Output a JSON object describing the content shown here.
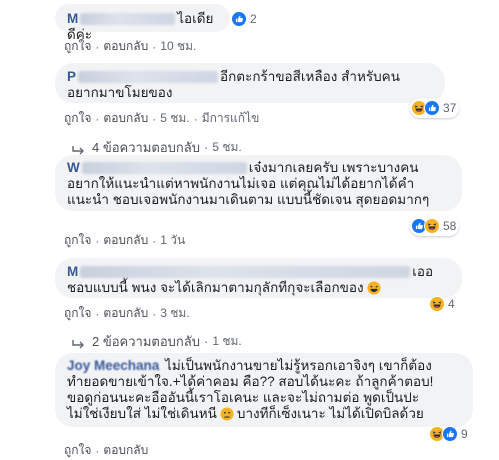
{
  "comments": [
    {
      "author": "M",
      "text": "ไอเดียดีค่ะ",
      "reactions": [
        "like"
      ],
      "reaction_count": "2",
      "actions": {
        "like": "ถูกใจ",
        "reply": "ตอบกลับ",
        "time": "10 ชม."
      }
    },
    {
      "author": "P",
      "line1": "อีกตะกร้าขอสีเหลือง สำหรับคน",
      "line2": "อยากมาขโมยของ",
      "reactions": [
        "haha",
        "like"
      ],
      "reaction_count": "37",
      "actions": {
        "like": "ถูกใจ",
        "reply": "ตอบกลับ",
        "time": "5 ชม.",
        "edited": "มีการแก้ไข"
      },
      "replies": "4 ข้อความตอบกลับ",
      "replies_time": "5 ชม."
    },
    {
      "author": "W",
      "line1": "เจ๋งมากเลยครับ เพราะบางคน",
      "line2": "อยากให้แนะนำแต่หาพนักงานไม่เจอ แต่คุณไม่ได้อยากได้คำ",
      "line3": "แนะนำ ชอบเจอพนักงานมาเดินตาม แบบนี้ชัดเจน สุดยอดมากๆ",
      "reactions": [
        "like",
        "haha"
      ],
      "reaction_count": "58",
      "actions": {
        "like": "ถูกใจ",
        "reply": "ตอบกลับ",
        "time": "1 วัน"
      }
    },
    {
      "author": "M",
      "line1": "เออ",
      "line2": "ชอบแบบนี้ พนง จะได้เลิกมาตามกุลักทีกุจะเลือกของ",
      "reactions": [
        "haha"
      ],
      "reaction_count": "4",
      "actions": {
        "like": "ถูกใจ",
        "reply": "ตอบกลับ",
        "time": "3 ชม."
      },
      "replies": "2 ข้อความตอบกลับ",
      "replies_time": "1 ชม."
    },
    {
      "author": "Joy Meechana",
      "line1": "ไม่เป็นพนักงานขายไม่รู้หรอกเอาจิงๆ เขาก็ต้อง",
      "line2": "ทำยอดขายเข้าใจ.+ได้ค่าคอม คือ?? สอบได้นะคะ ถ้าลูกค้าตอบ!",
      "line3": "ขอดูก่อนนะคะอืออันนี้เราโอเคนะ และจะไม่ถามต่อ พูดเป็นปะ",
      "line4": "ไม่ใช่เงียบใส่ ไม่ใช่เดินหนี",
      "line4b": "บางทีก็เซ็งเนาะ ไม่ได้เปิดบิลด้วย",
      "reactions": [
        "haha",
        "like"
      ],
      "reaction_count": "9",
      "actions": {
        "like": "ถูกใจ",
        "reply": "ตอบกลับ"
      }
    }
  ],
  "colors": {
    "bubble": "#f2f3f5",
    "link": "#385898",
    "like": "#1877f2",
    "haha": "#f7b125"
  }
}
